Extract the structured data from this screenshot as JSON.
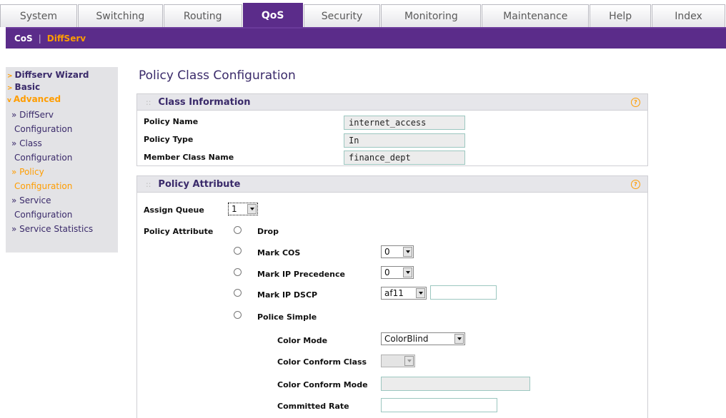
{
  "tabs": [
    {
      "label": "System",
      "active": false
    },
    {
      "label": "Switching",
      "active": false
    },
    {
      "label": "Routing",
      "active": false
    },
    {
      "label": "QoS",
      "active": true
    },
    {
      "label": "Security",
      "active": false
    },
    {
      "label": "Monitoring",
      "active": false
    },
    {
      "label": "Maintenance",
      "active": false
    },
    {
      "label": "Help",
      "active": false
    },
    {
      "label": "Index",
      "active": false
    }
  ],
  "subnav": {
    "cos": "CoS",
    "separator": "|",
    "diffserv": "DiffServ"
  },
  "sidebar": {
    "wizard": "Diffserv Wizard",
    "basic": "Basic",
    "advanced": "Advanced",
    "items": [
      {
        "line1": "» DiffServ",
        "line2": "Configuration"
      },
      {
        "line1": "» Class",
        "line2": "Configuration"
      },
      {
        "line1": "» Policy",
        "line2": "Configuration"
      },
      {
        "line1": "» Service",
        "line2": "Configuration"
      },
      {
        "line1": "» Service Statistics",
        "line2": ""
      }
    ]
  },
  "page": {
    "title": "Policy Class Configuration"
  },
  "class_info": {
    "header": "Class Information",
    "policy_name_label": "Policy Name",
    "policy_name": "internet_access",
    "policy_type_label": "Policy Type",
    "policy_type": "In",
    "member_class_label": "Member Class Name",
    "member_class": "finance_dept"
  },
  "policy_attr": {
    "header": "Policy Attribute",
    "assign_queue_label": "Assign Queue",
    "assign_queue": "1",
    "policy_attribute_label": "Policy Attribute",
    "drop": "Drop",
    "mark_cos": "Mark COS",
    "mark_cos_value": "0",
    "mark_ip_prec": "Mark IP Precedence",
    "mark_ip_prec_value": "0",
    "mark_ip_dscp": "Mark IP DSCP",
    "mark_ip_dscp_value": "af11",
    "mark_ip_dscp_text": "",
    "police_simple": "Police Simple",
    "color_mode_label": "Color Mode",
    "color_mode": "ColorBlind",
    "color_conform_class_label": "Color Conform Class",
    "color_conform_class": "",
    "color_conform_mode_label": "Color Conform Mode",
    "color_conform_mode": "",
    "committed_rate_label": "Committed Rate",
    "committed_rate": ""
  },
  "colors": {
    "purple": "#5b2c8a",
    "orange": "#ff9d00",
    "navy_text": "#3a2a6a"
  }
}
